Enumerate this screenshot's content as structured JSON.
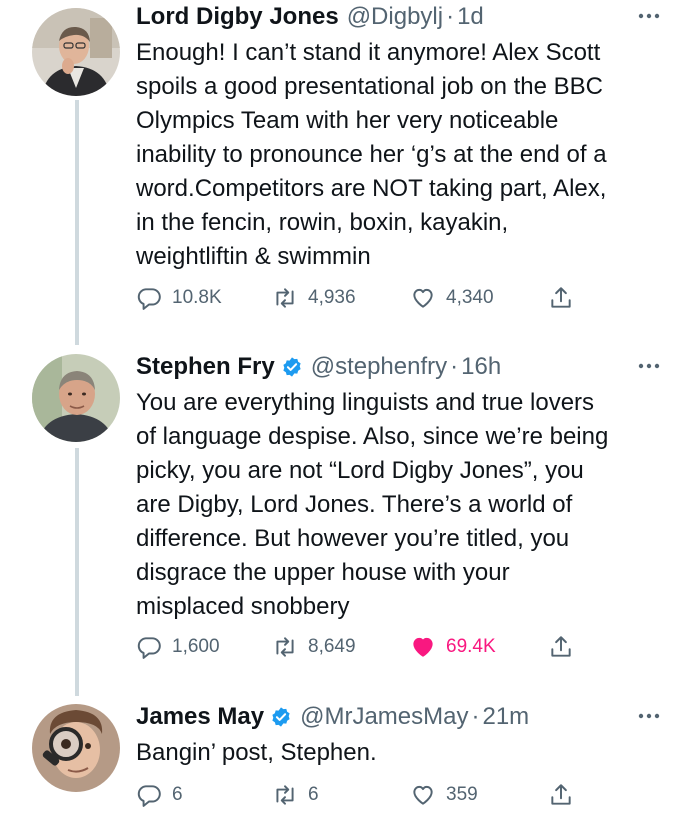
{
  "tweets": [
    {
      "name": "Lord Digby Jones",
      "handle": "@Digbylj",
      "separator": "·",
      "time": "1d",
      "verified": false,
      "lines": [
        "Enough! I can’t stand it anymore! Alex Scott",
        "spoils a good presentational job on the BBC",
        "Olympics Team with her very noticeable",
        "inability to pronounce her ‘g’s at the end of a",
        "word.Competitors are NOT taking part, Alex,",
        "in the fencin, rowin, boxin, kayakin,",
        "weightliftin & swimmin"
      ],
      "replies": "10.8K",
      "retweets": "4,936",
      "likes": "4,340",
      "liked": false
    },
    {
      "name": "Stephen Fry",
      "handle": "@stephenfry",
      "separator": "·",
      "time": "16h",
      "verified": true,
      "lines": [
        "You are everything linguists and true lovers",
        "of language despise. Also, since we’re being",
        "picky, you are not “Lord Digby Jones”, you",
        "are  Digby, Lord Jones. There’s a world of",
        "difference. But however you’re titled, you",
        "disgrace the upper house with your",
        "misplaced snobbery"
      ],
      "replies": "1,600",
      "retweets": "8,649",
      "likes": "69.4K",
      "liked": true
    },
    {
      "name": "James May",
      "handle": "@MrJamesMay",
      "separator": "·",
      "time": "21m",
      "verified": true,
      "lines": [
        "Bangin’ post, Stephen."
      ],
      "replies": "6",
      "retweets": "6",
      "likes": "359",
      "liked": false
    }
  ],
  "colors": {
    "text": "#0f1419",
    "secondary": "#536471",
    "like": "#f91880",
    "verified": "#1d9bf0",
    "thread_line": "#cfd9de"
  },
  "icons": {
    "reply": "reply-icon",
    "retweet": "retweet-icon",
    "like": "heart-icon",
    "share": "share-icon",
    "more": "more-icon",
    "verified": "verified-badge-icon"
  }
}
